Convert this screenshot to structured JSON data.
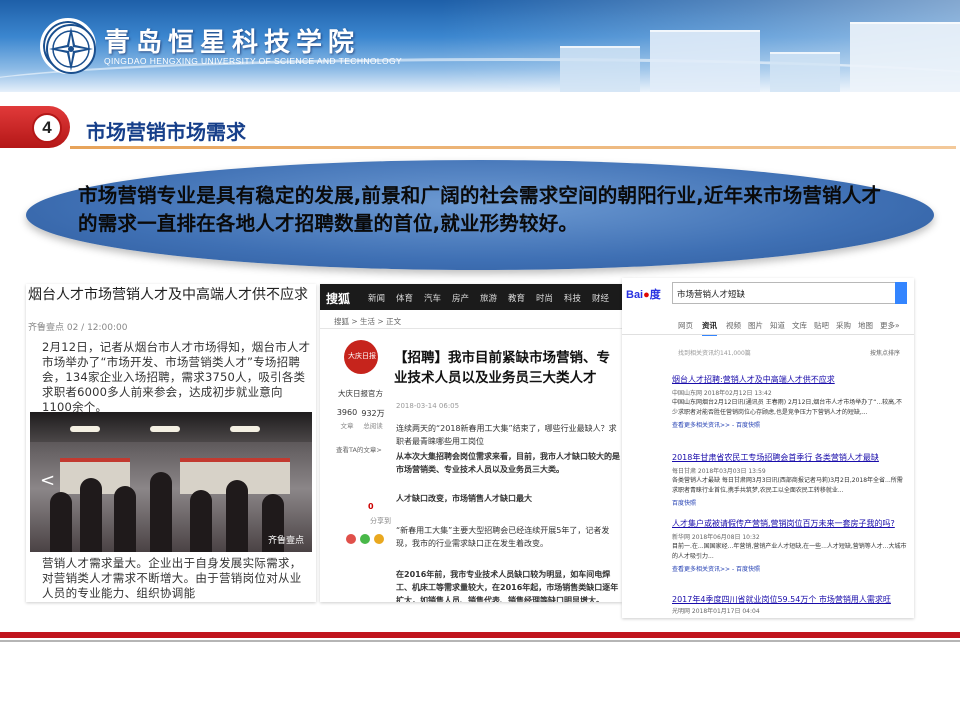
{
  "header": {
    "school_name_cn": "青岛恒星科技学院",
    "school_name_en": "QINGDAO HENGXING UNIVERSITY OF SCIENCE AND TECHNOLOGY"
  },
  "section": {
    "number": "4",
    "title": "市场营销市场需求"
  },
  "callout": {
    "text": "市场营销专业是具有稳定的发展,前景和广阔的社会需求空间的朝阳行业,近年来市场营销人才的需求一直排在各地人才招聘数量的首位,就业形势较好。"
  },
  "screenshot_news": {
    "headline": "烟台人才市场营销人才及中高端人才供不应求",
    "meta": "齐鲁壹点 02 / 12:00:00",
    "paragraph": "2月12日，记者从烟台市人才市场得知，烟台市人才市场举办了“市场开发、市场营销类人才”专场招聘会，134家企业入场招聘，需求3750人，吸引各类求职者6000多人前来参会，达成初步就业意向1100余个。",
    "photo_nav": "<",
    "photo_watermark": "齐鲁壹点",
    "paragraph2": "营销人才需求量大。企业出于自身发展实际需求，对营销类人才需求不断增大。由于营销岗位对从业人员的专业能力、组织协调能"
  },
  "screenshot_sohu": {
    "brand": "搜狐",
    "nav_items": [
      "新闻",
      "体育",
      "汽车",
      "房产",
      "旅游",
      "教育",
      "时尚",
      "科技",
      "财经"
    ],
    "breadcrumb": "搜狐 > 生活 > 正文",
    "account_name": "大庆日报官方",
    "stats": [
      {
        "value": "3960",
        "label": "文章"
      },
      {
        "value": "932万",
        "label": "总阅读"
      }
    ],
    "side_button": "查看TA的文章>",
    "title": "【招聘】我市目前紧缺市场营销、专业技术人员以及业务员三大类人才",
    "date": "2018-03-14 06:05",
    "paragraphs": [
      "连续两天的“2018新春用工大集”结束了，哪些行业最缺人？求职者最青睐哪些用工岗位",
      "从本次大集招聘会岗位需求来看，目前，我市人才缺口较大的是市场营销类、专业技术人员以及业务员三大类。",
      "人才缺口改变，市场销售人才缺口最大",
      "“新春用工大集”主要大型招聘会已经连续开展5年了，记者发现，我市的行业需求缺口正在发生着改变。",
      "在2016年前，我市专业技术人员缺口较为明显，如车间电焊工、机床工等需求量较大，在2016年起，市场销售类缺口逐年扩大，如销售人员、销售代表、销售经理等缺口明显增大。"
    ],
    "share_label": "分享到",
    "related_label": "0"
  },
  "screenshot_baidu": {
    "logo_a": "Bai",
    "logo_b": "度",
    "query": "市场营销人才短缺",
    "tabs": [
      "网页",
      "资讯",
      "视频",
      "图片",
      "知道",
      "文库",
      "贴吧",
      "采购",
      "地图",
      "更多»"
    ],
    "active_tab": "资讯",
    "count": "找到相关资讯约141,000篇",
    "tools": "按焦点排序",
    "results": [
      {
        "title": "烟台人才招聘:营销人才及中高端人才供不应求",
        "meta": "中国山东网 2018年02月12日 13:42",
        "snippet": "中国山东网烟台2月12日讯(通讯员 王春雨) 2月12日,烟台市人才市场举办了“...较高,不少求职者对能否胜任营销岗位心存顾虑,也是竞争压力下营销人才的短缺,...",
        "link": "查看更多相关资讯>> - 百度快照"
      },
      {
        "title": "2018年甘肃省农民工专场招聘会首季行 各类营销人才最缺",
        "meta": "每日甘肃 2018年03月03日 13:59",
        "snippet": "各类营销人才最缺 每日甘肃网3月3日讯(西部商报记者马莉)3月2日,2018年全省...所需求职者青睐行业首位,携手共筑梦,农民工以全面农民工转移就业...",
        "link": "百度快照"
      },
      {
        "title": "人才集户或被请假传产营销,营销岗位百万未来一套房子我的吗?",
        "meta": "新华网 2018年06月08日 10:32",
        "snippet": "目前一.在...国国家经...年营销,营销产业人才短缺,在一些...人才短缺,营销等人才...大城市的人才吸引力...",
        "link": "查看更多相关资讯>> - 百度快照"
      },
      {
        "title": "2017年4季度四川省就业岗位59.54万个 市场营销用人需求旺",
        "meta": "光明网 2018年01月17日 04:04",
        "snippet": "",
        "link": ""
      }
    ]
  }
}
